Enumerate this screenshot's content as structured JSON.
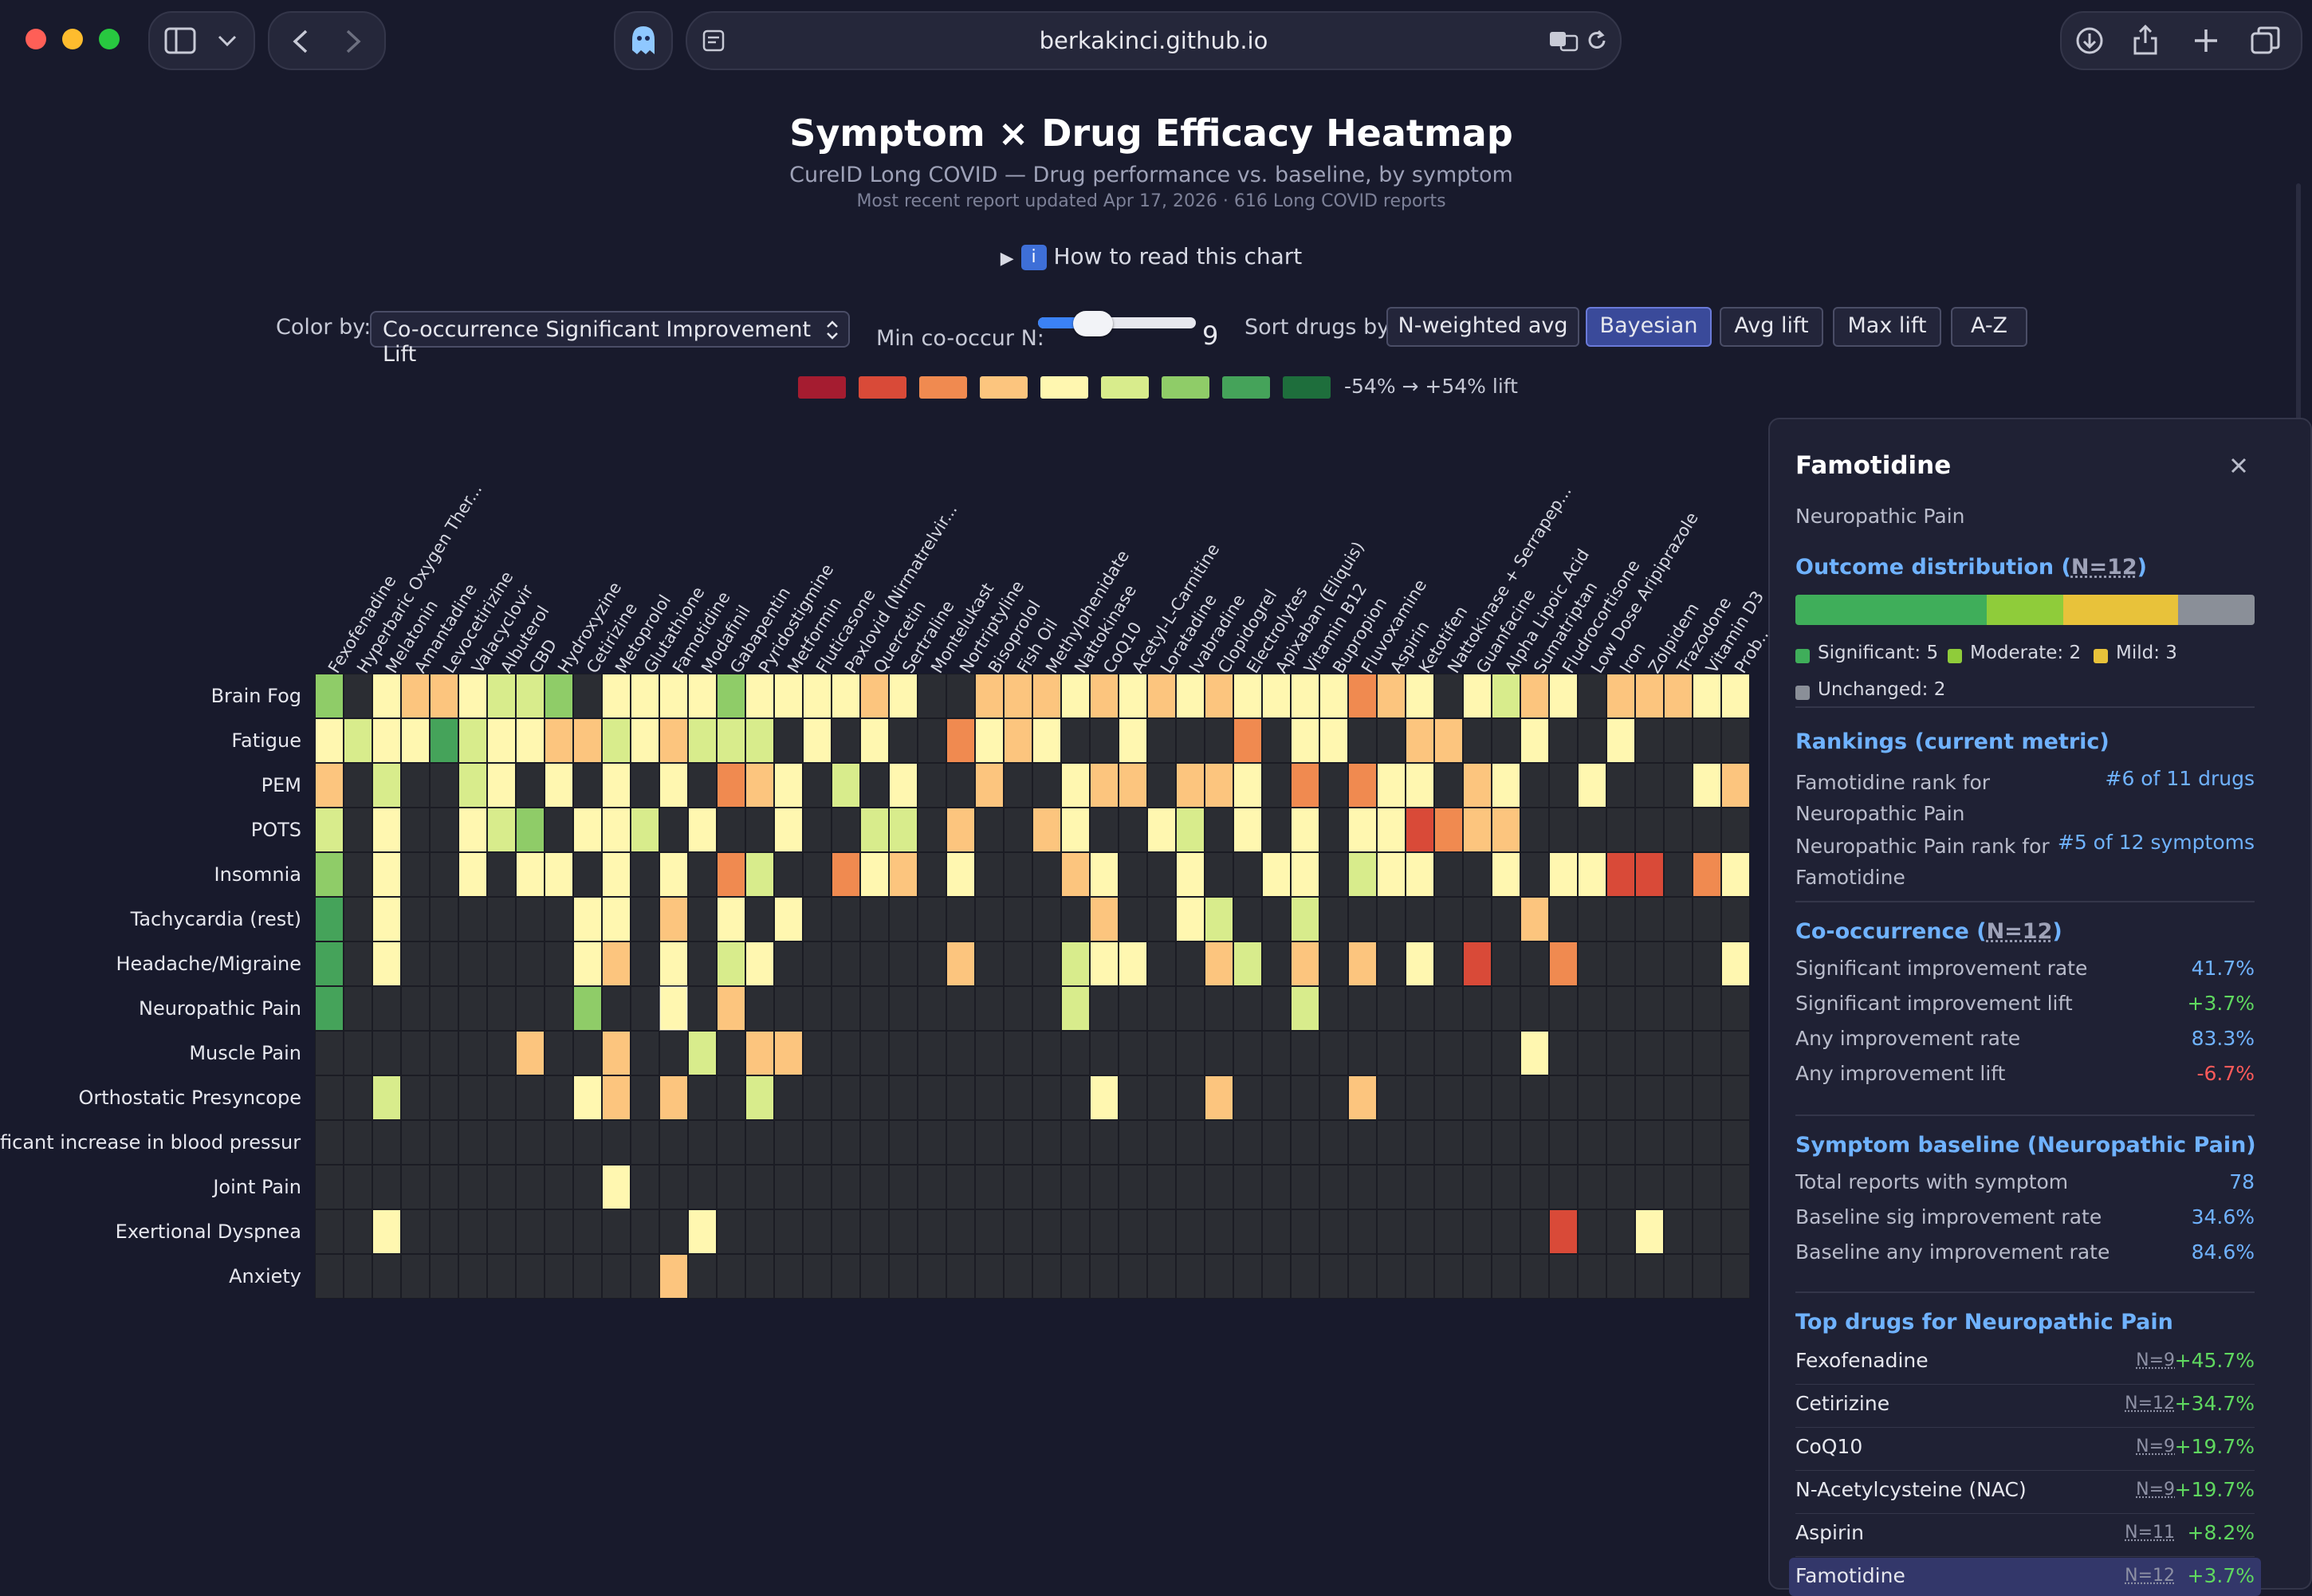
{
  "browser": {
    "url": "berkakinci.github.io",
    "icons": [
      "sidebar-icon",
      "chevron-down-icon",
      "back-icon",
      "forward-icon",
      "ghost-extension-icon",
      "reader-icon",
      "translate-icon",
      "reload-icon",
      "download-icon",
      "share-icon",
      "new-tab-icon",
      "tabs-overview-icon"
    ]
  },
  "header": {
    "title": "Symptom × Drug Efficacy Heatmap",
    "subtitle": "CureID Long COVID — Drug performance vs. baseline, by symptom",
    "updated": "Most recent report updated Apr 17, 2026 · 616 Long COVID reports",
    "howto": "How to read this chart"
  },
  "controls": {
    "color_by_label": "Color by:",
    "color_by_value": "Co-occurrence Significant Improvement Lift",
    "min_co_label": "Min co-occur N:",
    "min_co_value": "9",
    "min_co_fraction": 0.3,
    "sort_label": "Sort drugs by:",
    "sort_options": [
      "N-weighted avg",
      "Bayesian",
      "Avg lift",
      "Max lift",
      "A-Z"
    ],
    "sort_active": "Bayesian"
  },
  "legend": {
    "colors": [
      "#a51c30",
      "#d94a38",
      "#f08a50",
      "#fcc57e",
      "#fff7b0",
      "#d8ec8c",
      "#8fcc68",
      "#45a35a",
      "#1e6e3c"
    ],
    "text": "-54% → +54% lift"
  },
  "chart_data": {
    "type": "heatmap",
    "color_scale": {
      "min": -54,
      "max": 54,
      "unit": "% lift"
    },
    "symptoms": [
      "Brain Fog",
      "Fatigue",
      "PEM",
      "POTS",
      "Insomnia",
      "Tachycardia (rest)",
      "Headache/Migraine",
      "Neuropathic Pain",
      "Muscle Pain",
      "Orthostatic Presyncope",
      "ficant increase in blood pressure",
      "Joint Pain",
      "Exertional Dyspnea",
      "Anxiety"
    ],
    "drugs": [
      "Fexofenadine",
      "Hyperbaric Oxygen Ther...",
      "Melatonin",
      "Amantadine",
      "Levocetirizine",
      "Valacyclovir",
      "Albuterol",
      "CBD",
      "Hydroxyzine",
      "Cetirizine",
      "Metoprolol",
      "Glutathione",
      "Famotidine",
      "Modafinil",
      "Gabapentin",
      "Pyridostigmine",
      "Metformin",
      "Fluticasone",
      "Paxlovid (Nirmatrelvir...",
      "Quercetin",
      "Sertraline",
      "Montelukast",
      "Nortriptyline",
      "Bisoprolol",
      "Fish Oil",
      "Methylphenidate",
      "Nattokinase",
      "CoQ10",
      "Acetyl-L-Carnitine",
      "Loratadine",
      "Ivabradine",
      "Clopidogrel",
      "Electrolytes",
      "Apixaban (Eliquis)",
      "Vitamin B12",
      "Bupropion",
      "Fluvoxamine",
      "Aspirin",
      "Ketotifen",
      "Nattokinase + Serrapep...",
      "Guanfacine",
      "Alpha Lipoic Acid",
      "Sumatriptan",
      "Fludrocortisone",
      "Low Dose Aripiprazole",
      "Iron",
      "Zolpidem",
      "Trazodone",
      "Vitamin D3",
      "Prob..."
    ],
    "codes_legend": {
      "0": "no data",
      "1": "-54%",
      "2": "-40%",
      "3": "-25%",
      "4": "-10%",
      "5": "+5%",
      "6": "+18%",
      "7": "+30%",
      "8": "+42%",
      "9": "+54%"
    },
    "cells": [
      "7.5445667.55557555545..4445454545555345.5645.444554434",
      "5655865544654666.5.5..3545..5...3.55..44..5..5....",
      "4.6..65.5.5.5.345.6.5..4..544.445.3.355.45..5...54",
      "6.5..567.556.5..5..66.4..45..56.5.5.552344.......",
      "7.5..5.55.5.5.36..354.5...45..5..55.655..5.5522.356",
      "8.5......55.4.5.5..........4..56..6.......4.......5",
      "8.5......54.5.65......4...655..46.4.4.5.2..3.....5",
      "8........7..5.4...........6.......6..............",
      ".......4..4..6.44.........................5.......3",
      "..6......54.4..6...........5...4....4...........",
      "..................................................",
      "..........5.......................................",
      "..5..........5.............................2..5...5",
      "............4....................................."
    ]
  },
  "panel": {
    "title": "Famotidine",
    "subtitle": "Neuropathic Pain",
    "outcome_head": "Outcome distribution (",
    "outcome_n": "N=12",
    "outcome_close": ")",
    "outcome": [
      {
        "label": "Significant: 5",
        "count": 5,
        "color": "#3fae5a"
      },
      {
        "label": "Moderate: 2",
        "count": 2,
        "color": "#8fcc3a"
      },
      {
        "label": "Mild: 3",
        "count": 3,
        "color": "#e8c23a"
      },
      {
        "label": "Unchanged: 2",
        "count": 2,
        "color": "#8a8f98"
      }
    ],
    "rankings_head": "Rankings (current metric)",
    "rank1_label_a": "Famotidine rank for",
    "rank1_label_b": "Neuropathic Pain",
    "rank1_value": "#6 of 11 drugs",
    "rank2_label_a": "Neuropathic Pain rank for",
    "rank2_label_b": "Famotidine",
    "rank2_value": "#5 of 12 symptoms",
    "cooc_head": "Co-occurrence (",
    "cooc_n": "N=12",
    "cooc_close": ")",
    "cooc": [
      {
        "label": "Significant improvement rate",
        "value": "41.7%",
        "color": "#6fb2ff"
      },
      {
        "label": "Significant improvement lift",
        "value": "+3.7%",
        "color": "#5fd85f"
      },
      {
        "label": "Any improvement rate",
        "value": "83.3%",
        "color": "#6fb2ff"
      },
      {
        "label": "Any improvement lift",
        "value": "-6.7%",
        "color": "#ff5a5a"
      }
    ],
    "baseline_head": "Symptom baseline (Neuropathic Pain)",
    "baseline": [
      {
        "label": "Total reports with symptom",
        "value": "78"
      },
      {
        "label": "Baseline sig improvement rate",
        "value": "34.6%"
      },
      {
        "label": "Baseline any improvement rate",
        "value": "84.6%"
      }
    ],
    "top_head": "Top drugs for Neuropathic Pain",
    "top": [
      {
        "name": "Fexofenadine",
        "n": "N=9",
        "lift": "+45.7%"
      },
      {
        "name": "Cetirizine",
        "n": "N=12",
        "lift": "+34.7%"
      },
      {
        "name": "CoQ10",
        "n": "N=9",
        "lift": "+19.7%"
      },
      {
        "name": "N-Acetylcysteine (NAC)",
        "n": "N=9",
        "lift": "+19.7%"
      },
      {
        "name": "Aspirin",
        "n": "N=11",
        "lift": "+8.2%"
      },
      {
        "name": "Famotidine",
        "n": "N=12",
        "lift": "+3.7%"
      }
    ]
  }
}
